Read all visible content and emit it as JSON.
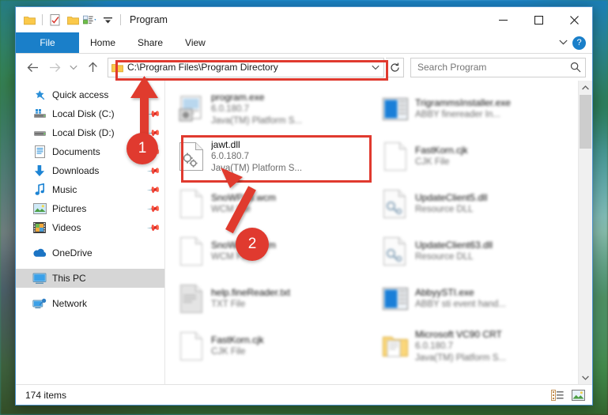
{
  "window": {
    "title": "Program",
    "quick_access_icons": [
      "folder-icon",
      "properties-icon",
      "new-folder-icon",
      "customize-icon",
      "dropdown-icon"
    ],
    "controls": {
      "minimize": "—",
      "maximize": "□",
      "close": "✕"
    }
  },
  "ribbon": {
    "tabs": [
      {
        "label": "File",
        "active": true
      },
      {
        "label": "Home",
        "active": false
      },
      {
        "label": "Share",
        "active": false
      },
      {
        "label": "View",
        "active": false
      }
    ],
    "collapse_icon": "chevron-down-icon",
    "help_label": "?"
  },
  "address": {
    "back_icon": "←",
    "forward_icon": "→",
    "recent_icon": "⌄",
    "up_icon": "↑",
    "path": "C:\\Program Files\\Program Directory",
    "dropdown_icon": "⌄",
    "refresh_icon": "↻"
  },
  "search": {
    "placeholder": "Search Program",
    "value": "",
    "icon": "search-icon"
  },
  "sidebar": {
    "items": [
      {
        "label": "Quick access",
        "icon": "star-pin-icon",
        "pinned": false,
        "selected": false
      },
      {
        "label": "Local Disk (C:)",
        "icon": "local-disk-c-icon",
        "pinned": true,
        "selected": false
      },
      {
        "label": "Local Disk (D:)",
        "icon": "local-disk-d-icon",
        "pinned": true,
        "selected": false
      },
      {
        "label": "Documents",
        "icon": "documents-icon",
        "pinned": true,
        "selected": false
      },
      {
        "label": "Downloads",
        "icon": "downloads-icon",
        "pinned": true,
        "selected": false
      },
      {
        "label": "Music",
        "icon": "music-icon",
        "pinned": true,
        "selected": false
      },
      {
        "label": "Pictures",
        "icon": "pictures-icon",
        "pinned": true,
        "selected": false
      },
      {
        "label": "Videos",
        "icon": "videos-icon",
        "pinned": true,
        "selected": false
      },
      {
        "label": "OneDrive",
        "icon": "onedrive-icon",
        "pinned": false,
        "selected": false,
        "gap_before": true
      },
      {
        "label": "This PC",
        "icon": "this-pc-icon",
        "pinned": false,
        "selected": true,
        "gap_before": true
      },
      {
        "label": "Network",
        "icon": "network-icon",
        "pinned": false,
        "selected": false,
        "gap_before": true
      }
    ]
  },
  "files": [
    {
      "name": "program.exe",
      "line2": "6.0.180.7",
      "line3": "Java(TM) Platform S...",
      "icon": "program-exe-icon",
      "blurred": true,
      "highlighted": false
    },
    {
      "name": "TrigrammsInstaller.exe",
      "line2": "ABBY finereader In...",
      "line3": "",
      "icon": "blue-app-icon",
      "blurred": true,
      "highlighted": false
    },
    {
      "name": "jawt.dll",
      "line2": "6.0.180.7",
      "line3": "Java(TM) Platform S...",
      "icon": "dll-gears-icon",
      "blurred": false,
      "highlighted": true
    },
    {
      "name": "FastKorn.cjk",
      "line2": "CJK File",
      "line3": "",
      "icon": "generic-file-icon",
      "blurred": true,
      "highlighted": false
    },
    {
      "name": "SnoWP13.wcm",
      "line2": "WCM File",
      "line3": "",
      "icon": "generic-file-icon",
      "blurred": true,
      "highlighted": false
    },
    {
      "name": "UpdateClient5.dll",
      "line2": "Resource DLL",
      "line3": "",
      "icon": "resource-dll-icon",
      "blurred": true,
      "highlighted": false
    },
    {
      "name": "SnoWP15.wcm",
      "line2": "WCM File",
      "line3": "",
      "icon": "generic-file-icon",
      "blurred": true,
      "highlighted": false
    },
    {
      "name": "UpdateClient63.dll",
      "line2": "Resource DLL",
      "line3": "",
      "icon": "resource-dll-icon",
      "blurred": true,
      "highlighted": false
    },
    {
      "name": "help.fineReader.txt",
      "line2": "TXT File",
      "line3": "",
      "icon": "text-file-icon",
      "blurred": true,
      "highlighted": false
    },
    {
      "name": "AbbyySTI.exe",
      "line2": "ABBY sti event hand...",
      "line3": "",
      "icon": "blue-app-icon",
      "blurred": true,
      "highlighted": false
    },
    {
      "name": "FastKorn.cjk",
      "line2": "CJK File",
      "line3": "",
      "icon": "generic-file-icon",
      "blurred": true,
      "highlighted": false
    },
    {
      "name": "Microsoft VC90 CRT",
      "line2": "6.0.180.7",
      "line3": "Java(TM) Platform S...",
      "icon": "folder-manifest-icon",
      "blurred": true,
      "highlighted": false
    }
  ],
  "scrollbar": {
    "up_icon": "⌃",
    "down_icon": "⌄"
  },
  "statusbar": {
    "item_count": "174 items",
    "view_details_icon": "details-view-icon",
    "view_large_icon": "large-icons-view-icon"
  },
  "annotations": {
    "accent_color": "#e03a2f",
    "markers": [
      {
        "label": "1",
        "target": "address-bar"
      },
      {
        "label": "2",
        "target": "jawt-dll-file"
      }
    ],
    "boxes": [
      {
        "target": "address-bar"
      },
      {
        "target": "jawt-dll-file"
      }
    ]
  }
}
